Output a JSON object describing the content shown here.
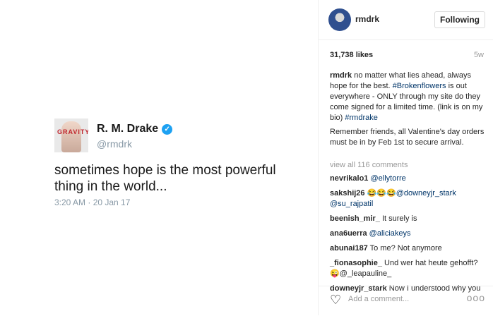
{
  "tweet": {
    "name": "R. M. Drake",
    "handle": "@rmdrk",
    "text": "sometimes hope is the most powerful thing in the world...",
    "time": "3:20 AM · 20 Jan 17",
    "avatar_text": "GRAVITY"
  },
  "post": {
    "username": "rmdrk",
    "follow_label": "Following",
    "likes": "31,738 likes",
    "age": "5w",
    "caption_user": "rmdrk",
    "caption_part1": "no matter what lies ahead, always hope for the best.",
    "caption_tag1": "#Brokenflowers",
    "caption_part2": "is out everywhere - ONLY through my site do they come signed for a limited time. (link is on my bio)",
    "caption_tag2": "#rmdrake",
    "caption_second": "Remember friends, all Valentine's day orders must be in by Feb 1st to secure arrival.",
    "view_all": "view all 116 comments"
  },
  "comments": [
    {
      "user": "nevrikalo1",
      "text": "@ellytorre"
    },
    {
      "user": "sakshij26",
      "text": "😂😂😂@downeyjr_stark @su_rajpatil"
    },
    {
      "user": "beenish_mir_",
      "text": "It surely is"
    },
    {
      "user": "ana6uerra",
      "text": "@aliciakeys"
    },
    {
      "user": "abunai187",
      "text": "To me? Not anymore"
    },
    {
      "user": "_fionasophie_",
      "text": "Und wer hat heute gehofft? 😜@_leapauline_"
    },
    {
      "user": "downeyjr_stark",
      "text": "Now I understood why you"
    }
  ],
  "footer": {
    "add_comment_placeholder": "Add a comment...",
    "more_label": "ooo",
    "heart_icon": "heart-icon"
  }
}
